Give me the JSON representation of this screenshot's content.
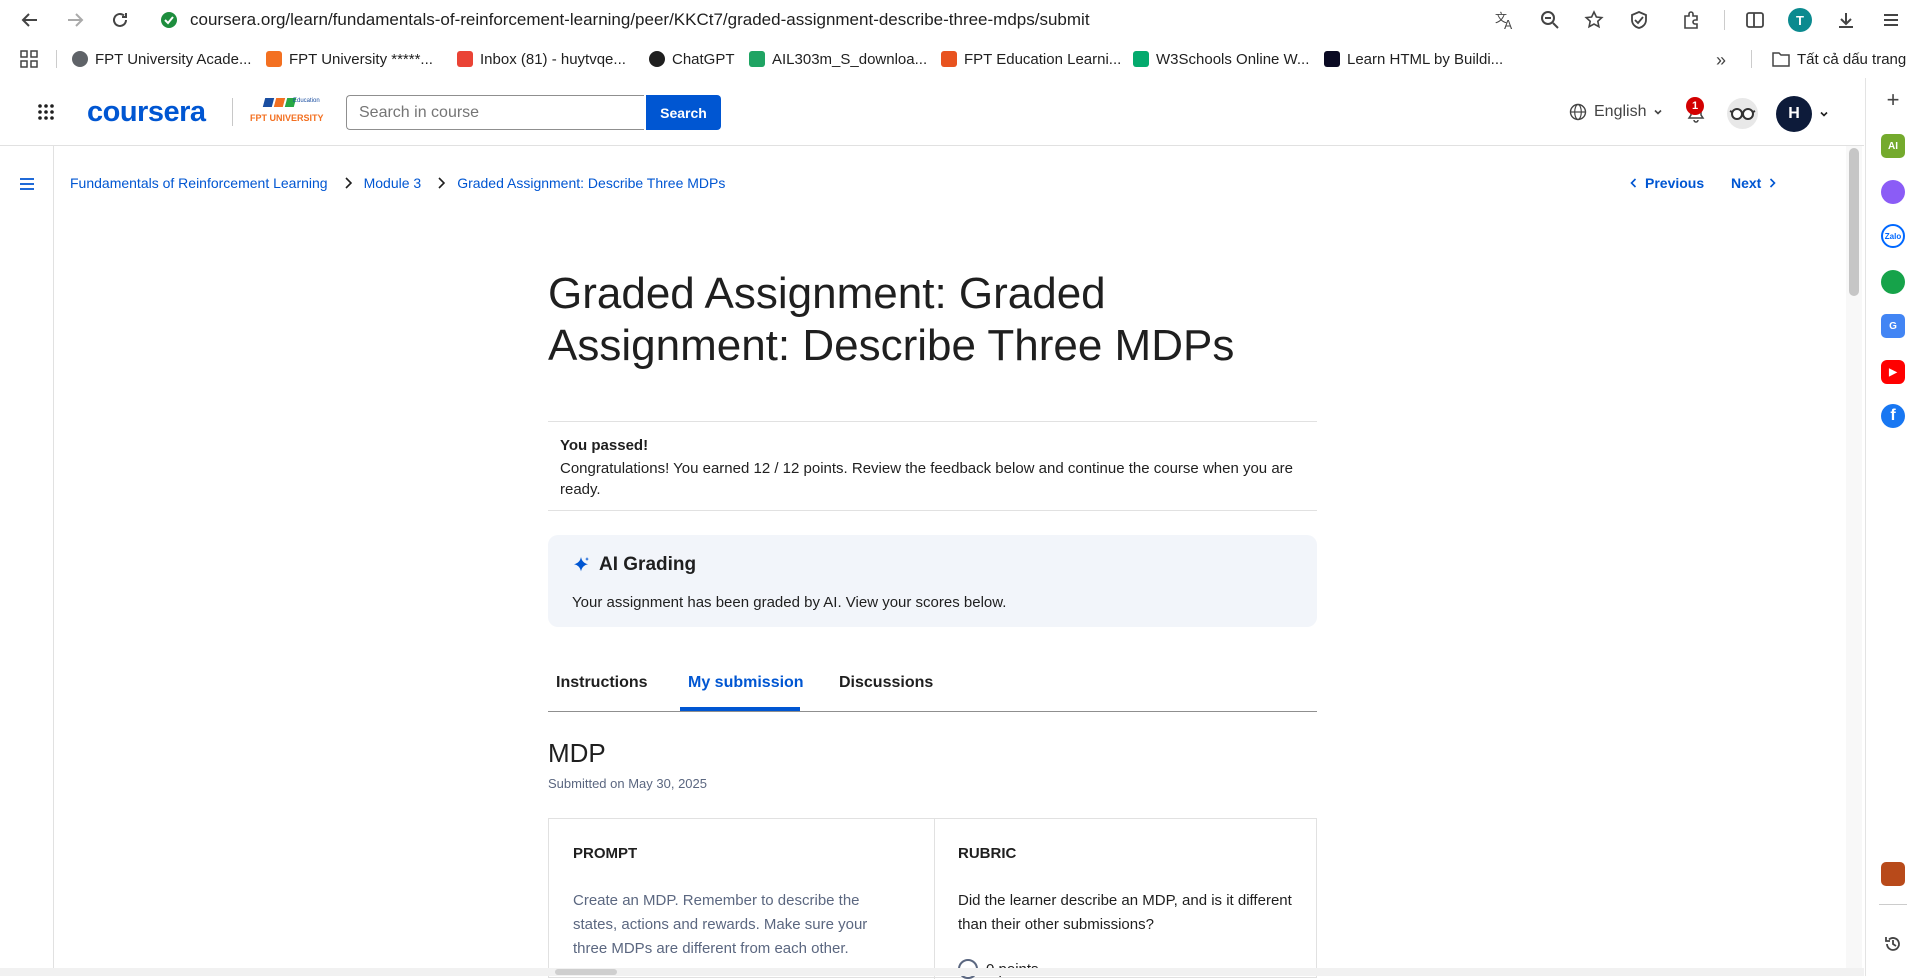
{
  "browser": {
    "url": "coursera.org/learn/fundamentals-of-reinforcement-learning/peer/KKCt7/graded-assignment-describe-three-mdps/submit",
    "profile_initial": "T",
    "bookmarks": [
      {
        "label": "FPT University Acade...",
        "icon": "globe-icon",
        "color": "#5f6368"
      },
      {
        "label": "FPT University *****...",
        "icon": "fpt-favicon",
        "color": "#f37021"
      },
      {
        "label": "Inbox (81) - huytvqe...",
        "icon": "gmail-icon",
        "color": "#ea4335"
      },
      {
        "label": "ChatGPT",
        "icon": "chatgpt-icon",
        "color": "#1f1f1f"
      },
      {
        "label": "AIL303m_S_downloa...",
        "icon": "google-drive-icon",
        "color": "#1fa463"
      },
      {
        "label": "FPT Education Learni...",
        "icon": "fpt-edu-icon",
        "color": "#e8531f"
      },
      {
        "label": "W3Schools Online W...",
        "icon": "w3schools-icon",
        "color": "#04aa6d"
      },
      {
        "label": "Learn HTML by Buildi...",
        "icon": "freecodecamp-icon",
        "color": "#0a0a23"
      }
    ],
    "all_bookmarks_label": "Tất cả dấu trang"
  },
  "header": {
    "logo_text": "coursera",
    "partner_top": "Education",
    "partner_bottom": "FPT UNIVERSITY",
    "search_placeholder": "Search in course",
    "search_button": "Search",
    "language": "English",
    "notification_count": "1",
    "avatar_initial": "H"
  },
  "breadcrumb": {
    "items": [
      "Fundamentals of Reinforcement Learning",
      "Module 3",
      "Graded Assignment: Describe Three MDPs"
    ],
    "previous": "Previous",
    "next": "Next"
  },
  "page": {
    "title": "Graded Assignment: Graded Assignment: Describe Three MDPs",
    "passed_heading": "You passed!",
    "passed_text": "Congratulations! You earned 12 / 12 points. Review the feedback below and continue the course when you are ready.",
    "ai_title": "AI Grading",
    "ai_text": "Your assignment has been graded by AI. View your scores below.",
    "tabs": [
      "Instructions",
      "My submission",
      "Discussions"
    ],
    "active_tab": "My submission",
    "submission_title": "MDP",
    "submitted_on": "Submitted on May 30, 2025",
    "prompt_heading": "PROMPT",
    "prompt_text": "Create an MDP. Remember to describe the states, actions and rewards. Make sure your three MDPs are different from each other.",
    "rubric_heading": "RUBRIC",
    "rubric_question": "Did the learner describe an MDP, and is it different than their other submissions?",
    "rubric_option": "0 points"
  },
  "colors": {
    "brand": "#0056d2",
    "fpt_orange": "#f37021",
    "notification": "#d30001",
    "ai_card": "#f2f5fa"
  }
}
